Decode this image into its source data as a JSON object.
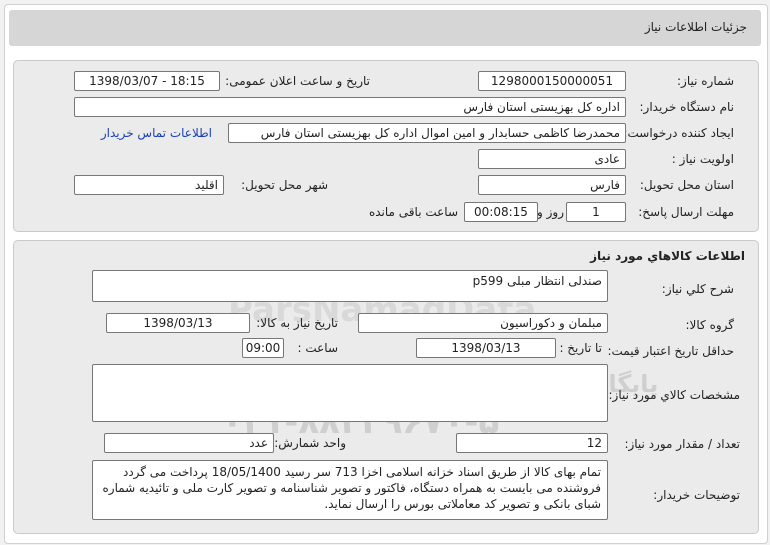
{
  "header": {
    "title": "جزئیات اطلاعات نیاز"
  },
  "info": {
    "need_number_label": "شماره نیاز:",
    "need_number": "1298000150000051",
    "announce_label": "تاریخ و ساعت اعلان عمومی:",
    "announce_value": "1398/03/07 - 18:15",
    "buyer_label": "نام دستگاه خریدار:",
    "buyer_value": "اداره کل بهزیستی استان فارس",
    "creator_label": "ایجاد کننده درخواست:",
    "creator_value": "محمدرضا کاظمی حسابدار و امین اموال اداره کل بهزیستی استان فارس",
    "contact_link": "اطلاعات تماس خریدار",
    "priority_label": "اولویت نیاز :",
    "priority_value": "عادی",
    "province_label": "استان محل تحویل:",
    "province_value": "فارس",
    "city_label": "شهر محل تحویل:",
    "city_value": "اقلید",
    "deadline_label": "مهلت ارسال پاسخ:",
    "deadline_days": "1",
    "days_label": "روز و",
    "deadline_time": "00:08:15",
    "remaining_label": "ساعت باقی مانده"
  },
  "goods": {
    "section_title": "اطلاعات کالاهاي مورد نياز",
    "desc_label": "شرح کلي نياز:",
    "desc_value": "صندلی انتظار مبلی p599",
    "group_label": "گروه کالا:",
    "group_value": "مبلمان و دکوراسیون",
    "need_date_label": "تاریخ نیاز به کالا:",
    "need_date_value": "1398/03/13",
    "validity_label": "حداقل تاریخ اعتبار قیمت:",
    "until_date_label": "تا تاریخ :",
    "validity_date": "1398/03/13",
    "time_label": "ساعت :",
    "validity_time": "09:00",
    "specs_label": "مشخصات کالاي مورد نياز:",
    "qty_label": "تعداد / مقدار مورد نیاز:",
    "qty_value": "12",
    "unit_label": "واحد شمارش:",
    "unit_value": "عدد",
    "notes_label": "توضیحات خریدار:",
    "notes_value": "تمام بهای کالا از طریق اسناد خزانه اسلامی اخزا 713 سر رسید 18/05/1400 پرداخت می گردد فروشنده می بایست به همراه دستگاه، فاکتور و تصویر شناسنامه و تصویر کارت ملی و تائیدیه شماره شبای بانکی و تصویر کد معاملاتی بورس را ارسال نماید."
  },
  "watermark": {
    "brand": "ParsNamadData",
    "caption": "پایگاه اطلاع رسانی مناقصه ومزایده",
    "phone": "۰۲۱-۸۸۳۴۹۶۷۰-۵"
  }
}
